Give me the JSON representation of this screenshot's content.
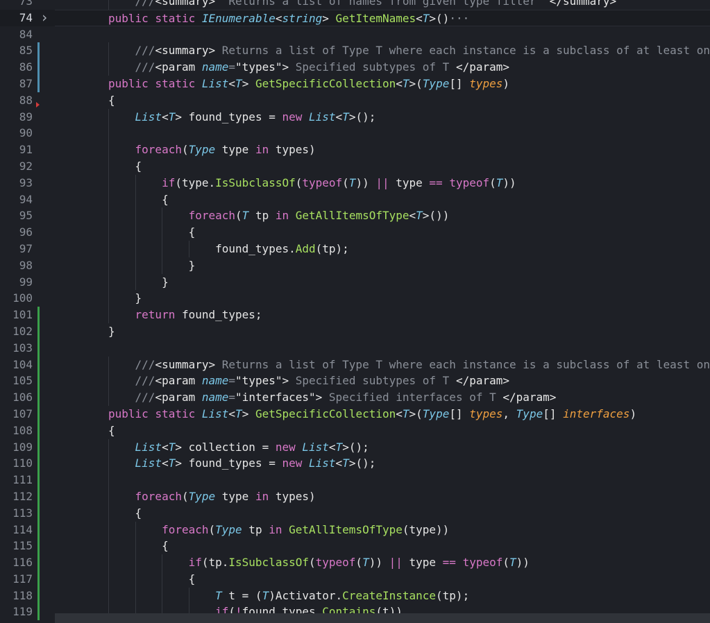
{
  "editor": {
    "colors": {
      "background": "#1e2026",
      "keyword": "#d878c8",
      "type": "#7cc8e8",
      "function": "#a8e060",
      "parameter": "#f0a040",
      "comment": "#8a8f98",
      "modified_bar": "#4f8fb0",
      "added_bar": "#3aa04a"
    },
    "current_line": 74,
    "lines": [
      {
        "n": "73",
        "indent": 1,
        "change": "",
        "fold": "",
        "tokens": [
          [
            "cm",
            "///"
          ],
          [
            "tag",
            "<summary>"
          ],
          [
            "cm",
            "  Returns a list of names from given type filter  "
          ],
          [
            "tag",
            "</summary>"
          ]
        ]
      },
      {
        "n": "74",
        "indent": 0,
        "change": "",
        "fold": "chevron-right",
        "tokens": [
          [
            "kw",
            "public"
          ],
          [
            "pl",
            " "
          ],
          [
            "kw",
            "static"
          ],
          [
            "pl",
            " "
          ],
          [
            "ty",
            "IEnumerable"
          ],
          [
            "pl",
            "<"
          ],
          [
            "ty",
            "string"
          ],
          [
            "pl",
            "> "
          ],
          [
            "fn",
            "GetItemNames"
          ],
          [
            "pl",
            "<"
          ],
          [
            "ty",
            "T"
          ],
          [
            "pl",
            ">()"
          ],
          [
            "ell",
            "···"
          ]
        ]
      },
      {
        "n": "84",
        "indent": 0,
        "change": "",
        "fold": "",
        "tokens": []
      },
      {
        "n": "85",
        "indent": 1,
        "change": "modified",
        "fold": "",
        "tokens": [
          [
            "cm",
            "///"
          ],
          [
            "tag",
            "<summary>"
          ],
          [
            "cm",
            " Returns a list of Type T where each instance is a subclass of at least on"
          ]
        ]
      },
      {
        "n": "86",
        "indent": 1,
        "change": "modified",
        "fold": "",
        "tokens": [
          [
            "cm",
            "///"
          ],
          [
            "tag",
            "<param "
          ],
          [
            "ty",
            "name"
          ],
          [
            "cm",
            "="
          ],
          [
            "str",
            "\"types\""
          ],
          [
            "tag",
            ">"
          ],
          [
            "cm",
            " Specified subtypes of T "
          ],
          [
            "tag",
            "</param>"
          ]
        ]
      },
      {
        "n": "87",
        "indent": 0,
        "change": "modified",
        "fold": "",
        "tokens": [
          [
            "kw",
            "public"
          ],
          [
            "pl",
            " "
          ],
          [
            "kw",
            "static"
          ],
          [
            "pl",
            " "
          ],
          [
            "ty",
            "List"
          ],
          [
            "pl",
            "<"
          ],
          [
            "ty",
            "T"
          ],
          [
            "pl",
            "> "
          ],
          [
            "fn",
            "GetSpecificCollection"
          ],
          [
            "pl",
            "<"
          ],
          [
            "ty",
            "T"
          ],
          [
            "pl",
            ">("
          ],
          [
            "ty",
            "Type"
          ],
          [
            "pl",
            "[] "
          ],
          [
            "par",
            "types"
          ],
          [
            "pl",
            ")"
          ]
        ]
      },
      {
        "n": "88",
        "indent": 0,
        "change": "",
        "fold": "",
        "tokens": [
          [
            "pl",
            "{"
          ]
        ]
      },
      {
        "n": "89",
        "indent": 1,
        "change": "",
        "fold": "",
        "tokens": [
          [
            "ty",
            "List"
          ],
          [
            "pl",
            "<"
          ],
          [
            "ty",
            "T"
          ],
          [
            "pl",
            "> found_types = "
          ],
          [
            "kw",
            "new"
          ],
          [
            "pl",
            " "
          ],
          [
            "ty",
            "List"
          ],
          [
            "pl",
            "<"
          ],
          [
            "ty",
            "T"
          ],
          [
            "pl",
            ">();"
          ]
        ]
      },
      {
        "n": "90",
        "indent": 1,
        "change": "",
        "fold": "",
        "tokens": []
      },
      {
        "n": "91",
        "indent": 1,
        "change": "",
        "fold": "",
        "tokens": [
          [
            "kw",
            "foreach"
          ],
          [
            "pl",
            "("
          ],
          [
            "ty",
            "Type"
          ],
          [
            "pl",
            " type "
          ],
          [
            "kw",
            "in"
          ],
          [
            "pl",
            " types)"
          ]
        ]
      },
      {
        "n": "92",
        "indent": 1,
        "change": "",
        "fold": "",
        "tokens": [
          [
            "pl",
            "{"
          ]
        ]
      },
      {
        "n": "93",
        "indent": 2,
        "change": "",
        "fold": "",
        "tokens": [
          [
            "kw",
            "if"
          ],
          [
            "pl",
            "(type."
          ],
          [
            "fn",
            "IsSubclassOf"
          ],
          [
            "pl",
            "("
          ],
          [
            "kw",
            "typeof"
          ],
          [
            "pl",
            "("
          ],
          [
            "ty",
            "T"
          ],
          [
            "pl",
            ")) "
          ],
          [
            "op",
            "||"
          ],
          [
            "pl",
            " type "
          ],
          [
            "op",
            "=="
          ],
          [
            "pl",
            " "
          ],
          [
            "kw",
            "typeof"
          ],
          [
            "pl",
            "("
          ],
          [
            "ty",
            "T"
          ],
          [
            "pl",
            "))"
          ]
        ]
      },
      {
        "n": "94",
        "indent": 2,
        "change": "",
        "fold": "",
        "tokens": [
          [
            "pl",
            "{"
          ]
        ]
      },
      {
        "n": "95",
        "indent": 3,
        "change": "",
        "fold": "",
        "tokens": [
          [
            "kw",
            "foreach"
          ],
          [
            "pl",
            "("
          ],
          [
            "ty",
            "T"
          ],
          [
            "pl",
            " tp "
          ],
          [
            "kw",
            "in"
          ],
          [
            "pl",
            " "
          ],
          [
            "fn",
            "GetAllItemsOfType"
          ],
          [
            "pl",
            "<"
          ],
          [
            "ty",
            "T"
          ],
          [
            "pl",
            ">())"
          ]
        ]
      },
      {
        "n": "96",
        "indent": 3,
        "change": "",
        "fold": "",
        "tokens": [
          [
            "pl",
            "{"
          ]
        ]
      },
      {
        "n": "97",
        "indent": 4,
        "change": "",
        "fold": "",
        "tokens": [
          [
            "pl",
            "found_types."
          ],
          [
            "fn",
            "Add"
          ],
          [
            "pl",
            "(tp);"
          ]
        ]
      },
      {
        "n": "98",
        "indent": 3,
        "change": "",
        "fold": "",
        "tokens": [
          [
            "pl",
            "}"
          ]
        ]
      },
      {
        "n": "99",
        "indent": 2,
        "change": "",
        "fold": "",
        "tokens": [
          [
            "pl",
            "}"
          ]
        ]
      },
      {
        "n": "100",
        "indent": 1,
        "change": "",
        "fold": "",
        "tokens": [
          [
            "pl",
            "}"
          ]
        ]
      },
      {
        "n": "101",
        "indent": 1,
        "change": "added",
        "fold": "",
        "tokens": [
          [
            "kw",
            "return"
          ],
          [
            "pl",
            " found_types;"
          ]
        ]
      },
      {
        "n": "102",
        "indent": 0,
        "change": "added",
        "fold": "",
        "tokens": [
          [
            "pl",
            "}"
          ]
        ]
      },
      {
        "n": "103",
        "indent": 0,
        "change": "added",
        "fold": "",
        "tokens": []
      },
      {
        "n": "104",
        "indent": 1,
        "change": "added",
        "fold": "",
        "tokens": [
          [
            "cm",
            "///"
          ],
          [
            "tag",
            "<summary>"
          ],
          [
            "cm",
            " Returns a list of Type T where each instance is a subclass of at least on"
          ]
        ]
      },
      {
        "n": "105",
        "indent": 1,
        "change": "added",
        "fold": "",
        "tokens": [
          [
            "cm",
            "///"
          ],
          [
            "tag",
            "<param "
          ],
          [
            "ty",
            "name"
          ],
          [
            "cm",
            "="
          ],
          [
            "str",
            "\"types\""
          ],
          [
            "tag",
            ">"
          ],
          [
            "cm",
            " Specified subtypes of T "
          ],
          [
            "tag",
            "</param>"
          ]
        ]
      },
      {
        "n": "106",
        "indent": 1,
        "change": "added",
        "fold": "",
        "tokens": [
          [
            "cm",
            "///"
          ],
          [
            "tag",
            "<param "
          ],
          [
            "ty",
            "name"
          ],
          [
            "cm",
            "="
          ],
          [
            "str",
            "\"interfaces\""
          ],
          [
            "tag",
            ">"
          ],
          [
            "cm",
            " Specified interfaces of T "
          ],
          [
            "tag",
            "</param>"
          ]
        ]
      },
      {
        "n": "107",
        "indent": 0,
        "change": "added",
        "fold": "",
        "tokens": [
          [
            "kw",
            "public"
          ],
          [
            "pl",
            " "
          ],
          [
            "kw",
            "static"
          ],
          [
            "pl",
            " "
          ],
          [
            "ty",
            "List"
          ],
          [
            "pl",
            "<"
          ],
          [
            "ty",
            "T"
          ],
          [
            "pl",
            "> "
          ],
          [
            "fn",
            "GetSpecificCollection"
          ],
          [
            "pl",
            "<"
          ],
          [
            "ty",
            "T"
          ],
          [
            "pl",
            ">("
          ],
          [
            "ty",
            "Type"
          ],
          [
            "pl",
            "[] "
          ],
          [
            "par",
            "types"
          ],
          [
            "pl",
            ", "
          ],
          [
            "ty",
            "Type"
          ],
          [
            "pl",
            "[] "
          ],
          [
            "par",
            "interfaces"
          ],
          [
            "pl",
            ")"
          ]
        ]
      },
      {
        "n": "108",
        "indent": 0,
        "change": "added",
        "fold": "",
        "tokens": [
          [
            "pl",
            "{"
          ]
        ]
      },
      {
        "n": "109",
        "indent": 1,
        "change": "added",
        "fold": "",
        "tokens": [
          [
            "ty",
            "List"
          ],
          [
            "pl",
            "<"
          ],
          [
            "ty",
            "T"
          ],
          [
            "pl",
            "> collection = "
          ],
          [
            "kw",
            "new"
          ],
          [
            "pl",
            " "
          ],
          [
            "ty",
            "List"
          ],
          [
            "pl",
            "<"
          ],
          [
            "ty",
            "T"
          ],
          [
            "pl",
            ">();"
          ]
        ]
      },
      {
        "n": "110",
        "indent": 1,
        "change": "added",
        "fold": "",
        "tokens": [
          [
            "ty",
            "List"
          ],
          [
            "pl",
            "<"
          ],
          [
            "ty",
            "T"
          ],
          [
            "pl",
            "> found_types = "
          ],
          [
            "kw",
            "new"
          ],
          [
            "pl",
            " "
          ],
          [
            "ty",
            "List"
          ],
          [
            "pl",
            "<"
          ],
          [
            "ty",
            "T"
          ],
          [
            "pl",
            ">();"
          ]
        ]
      },
      {
        "n": "111",
        "indent": 1,
        "change": "added",
        "fold": "",
        "tokens": []
      },
      {
        "n": "112",
        "indent": 1,
        "change": "added",
        "fold": "",
        "tokens": [
          [
            "kw",
            "foreach"
          ],
          [
            "pl",
            "("
          ],
          [
            "ty",
            "Type"
          ],
          [
            "pl",
            " type "
          ],
          [
            "kw",
            "in"
          ],
          [
            "pl",
            " types)"
          ]
        ]
      },
      {
        "n": "113",
        "indent": 1,
        "change": "added",
        "fold": "",
        "tokens": [
          [
            "pl",
            "{"
          ]
        ]
      },
      {
        "n": "114",
        "indent": 2,
        "change": "added",
        "fold": "",
        "tokens": [
          [
            "kw",
            "foreach"
          ],
          [
            "pl",
            "("
          ],
          [
            "ty",
            "Type"
          ],
          [
            "pl",
            " tp "
          ],
          [
            "kw",
            "in"
          ],
          [
            "pl",
            " "
          ],
          [
            "fn",
            "GetAllItemsOfType"
          ],
          [
            "pl",
            "(type))"
          ]
        ]
      },
      {
        "n": "115",
        "indent": 2,
        "change": "added",
        "fold": "",
        "tokens": [
          [
            "pl",
            "{"
          ]
        ]
      },
      {
        "n": "116",
        "indent": 3,
        "change": "added",
        "fold": "",
        "tokens": [
          [
            "kw",
            "if"
          ],
          [
            "pl",
            "(tp."
          ],
          [
            "fn",
            "IsSubclassOf"
          ],
          [
            "pl",
            "("
          ],
          [
            "kw",
            "typeof"
          ],
          [
            "pl",
            "("
          ],
          [
            "ty",
            "T"
          ],
          [
            "pl",
            ")) "
          ],
          [
            "op",
            "||"
          ],
          [
            "pl",
            " type "
          ],
          [
            "op",
            "=="
          ],
          [
            "pl",
            " "
          ],
          [
            "kw",
            "typeof"
          ],
          [
            "pl",
            "("
          ],
          [
            "ty",
            "T"
          ],
          [
            "pl",
            "))"
          ]
        ]
      },
      {
        "n": "117",
        "indent": 3,
        "change": "added",
        "fold": "",
        "tokens": [
          [
            "pl",
            "{"
          ]
        ]
      },
      {
        "n": "118",
        "indent": 4,
        "change": "added",
        "fold": "",
        "tokens": [
          [
            "ty",
            "T"
          ],
          [
            "pl",
            " t = ("
          ],
          [
            "ty",
            "T"
          ],
          [
            "pl",
            ")Activator."
          ],
          [
            "fn",
            "CreateInstance"
          ],
          [
            "pl",
            "(tp);"
          ]
        ]
      },
      {
        "n": "119",
        "indent": 4,
        "change": "added",
        "fold": "",
        "tokens": [
          [
            "kw",
            "if"
          ],
          [
            "pl",
            "("
          ],
          [
            "op",
            "!"
          ],
          [
            "pl",
            "found_types."
          ],
          [
            "fn",
            "Contains"
          ],
          [
            "pl",
            "(t))"
          ]
        ]
      }
    ]
  }
}
